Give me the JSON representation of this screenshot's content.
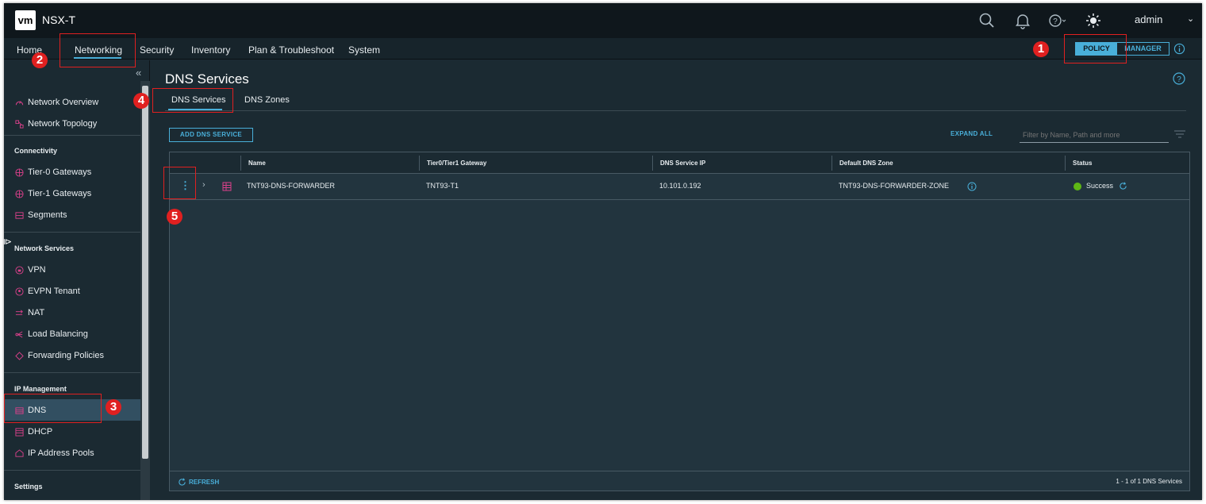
{
  "header": {
    "logo": "vm",
    "app_title": "NSX-T",
    "user": "admin",
    "icons": [
      "search-icon",
      "bell-icon",
      "help-icon",
      "theme-sun-icon"
    ]
  },
  "nav": {
    "items": [
      "Home",
      "Networking",
      "Security",
      "Inventory",
      "Plan & Troubleshoot",
      "System"
    ],
    "active": "Networking",
    "mode_toggle": {
      "policy": "POLICY",
      "manager": "MANAGER",
      "selected": "POLICY"
    }
  },
  "sidebar": {
    "top_items": [
      "Network Overview",
      "Network Topology"
    ],
    "sections": [
      {
        "heading": "Connectivity",
        "items": [
          "Tier-0 Gateways",
          "Tier-1 Gateways",
          "Segments"
        ]
      },
      {
        "heading": "Network Services",
        "items": [
          "VPN",
          "EVPN Tenant",
          "NAT",
          "Load Balancing",
          "Forwarding Policies"
        ]
      },
      {
        "heading": "IP Management",
        "items": [
          "DNS",
          "DHCP",
          "IP Address Pools"
        ]
      },
      {
        "heading": "Settings",
        "items": []
      }
    ],
    "selected": "DNS"
  },
  "main": {
    "title": "DNS Services",
    "tabs": [
      "DNS Services",
      "DNS Zones"
    ],
    "active_tab": "DNS Services",
    "add_button": "ADD DNS SERVICE",
    "expand_all": "EXPAND ALL",
    "filter_placeholder": "Filter by Name, Path and more",
    "columns": [
      "Name",
      "Tier0/Tier1 Gateway",
      "DNS Service IP",
      "Default DNS Zone",
      "Status"
    ],
    "rows": [
      {
        "name": "TNT93-DNS-FORWARDER",
        "gateway": "TNT93-T1",
        "ip": "10.101.0.192",
        "zone": "TNT93-DNS-FORWARDER-ZONE",
        "status": "Success"
      }
    ],
    "refresh": "REFRESH",
    "pagination": "1 - 1 of 1 DNS Services"
  },
  "annotations": [
    "1",
    "2",
    "3",
    "4",
    "5"
  ],
  "colors": {
    "accent": "#49afd9",
    "success": "#5eb715",
    "annotation": "#e02020",
    "icon_magenta": "#d9408a"
  }
}
